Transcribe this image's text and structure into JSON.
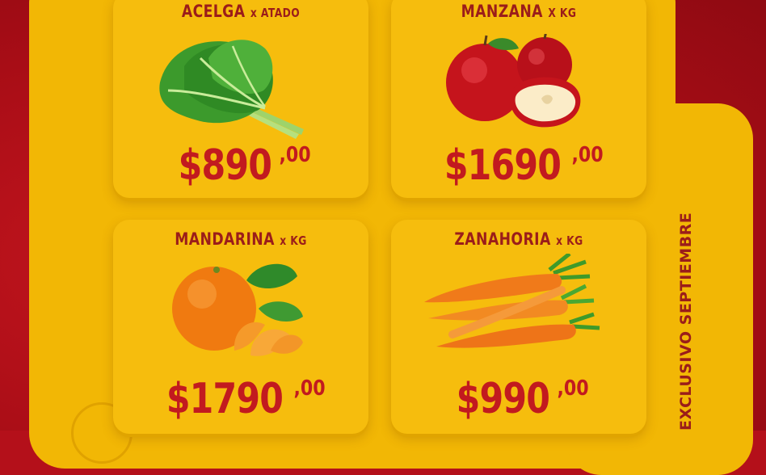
{
  "side_text": "EXCLUSIVO SEPTIEMBRE",
  "products": [
    {
      "name": "ACELGA",
      "unit": "x ATADO",
      "price_main": "$890",
      "price_cents": ",00",
      "icon": "chard-image"
    },
    {
      "name": "MANZANA",
      "unit": "X KG",
      "price_main": "$1690",
      "price_cents": ",00",
      "icon": "apple-image"
    },
    {
      "name": "MANDARINA",
      "unit": "x KG",
      "price_main": "$1790",
      "price_cents": ",00",
      "icon": "mandarin-image"
    },
    {
      "name": "ZANAHORIA",
      "unit": "x KG",
      "price_main": "$990",
      "price_cents": ",00",
      "icon": "carrot-image"
    }
  ],
  "colors": {
    "background_red": "#b4101a",
    "panel_yellow": "#f2b705",
    "price_red": "#c21a1f",
    "title_maroon": "#9b1d1a"
  }
}
